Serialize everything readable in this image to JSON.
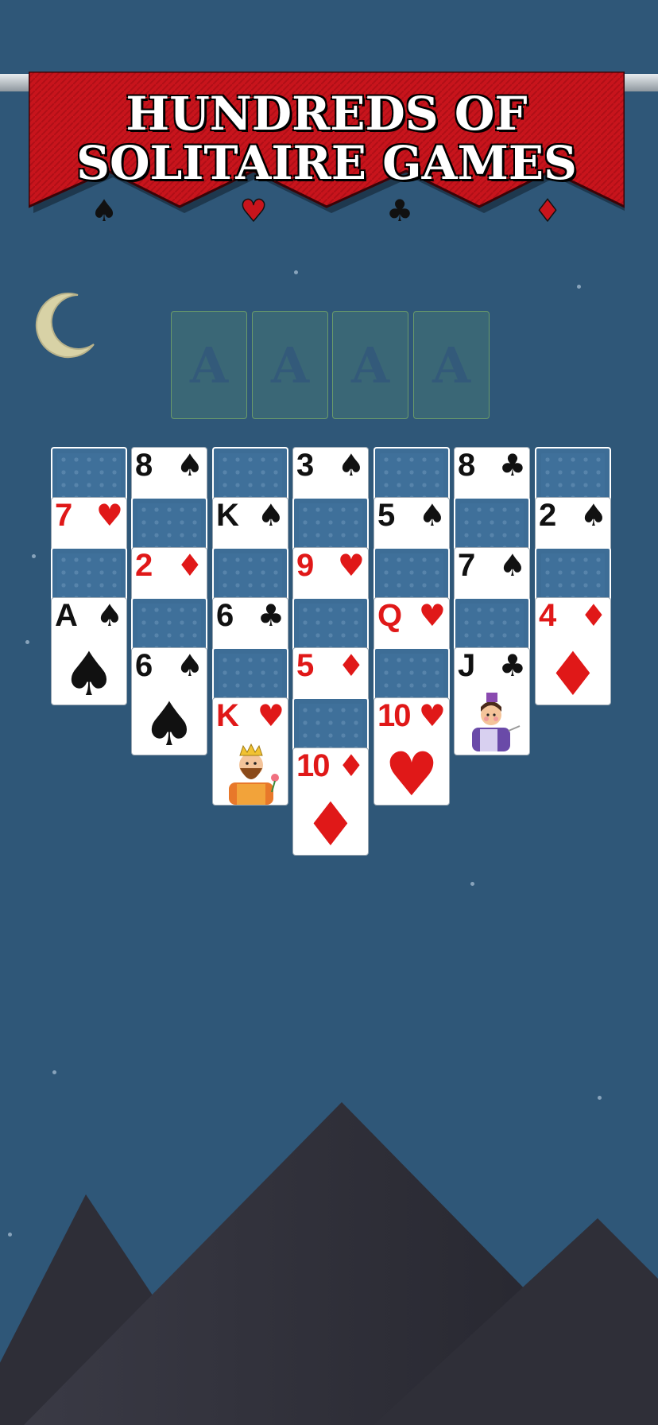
{
  "banner": {
    "line1": "HUNDREDS OF",
    "line2": "SOLITAIRE GAMES",
    "suits": [
      "spade-icon",
      "heart-icon",
      "club-icon",
      "diamond-icon"
    ],
    "color": "#c8141c"
  },
  "foundations": [
    {
      "label": "A"
    },
    {
      "label": "A"
    },
    {
      "label": "A"
    },
    {
      "label": "A"
    }
  ],
  "tableau": {
    "columns": [
      [
        {
          "face": "down"
        },
        {
          "face": "up",
          "rank": "7",
          "suit": "♥",
          "color": "red"
        },
        {
          "face": "down"
        },
        {
          "face": "up",
          "rank": "A",
          "suit": "♠",
          "color": "black"
        }
      ],
      [
        {
          "face": "up",
          "rank": "8",
          "suit": "♠",
          "color": "black"
        },
        {
          "face": "down"
        },
        {
          "face": "up",
          "rank": "2",
          "suit": "♦",
          "color": "red"
        },
        {
          "face": "down"
        },
        {
          "face": "up",
          "rank": "6",
          "suit": "♠",
          "color": "black"
        }
      ],
      [
        {
          "face": "down"
        },
        {
          "face": "up",
          "rank": "K",
          "suit": "♠",
          "color": "black"
        },
        {
          "face": "down"
        },
        {
          "face": "up",
          "rank": "6",
          "suit": "♣",
          "color": "black"
        },
        {
          "face": "down"
        },
        {
          "face": "up",
          "rank": "K",
          "suit": "♥",
          "color": "red",
          "figure": "king"
        }
      ],
      [
        {
          "face": "up",
          "rank": "3",
          "suit": "♠",
          "color": "black"
        },
        {
          "face": "down"
        },
        {
          "face": "up",
          "rank": "9",
          "suit": "♥",
          "color": "red"
        },
        {
          "face": "down"
        },
        {
          "face": "up",
          "rank": "5",
          "suit": "♦",
          "color": "red"
        },
        {
          "face": "down"
        },
        {
          "face": "up",
          "rank": "10",
          "suit": "♦",
          "color": "red"
        }
      ],
      [
        {
          "face": "down"
        },
        {
          "face": "up",
          "rank": "5",
          "suit": "♠",
          "color": "black"
        },
        {
          "face": "down"
        },
        {
          "face": "up",
          "rank": "Q",
          "suit": "♥",
          "color": "red"
        },
        {
          "face": "down"
        },
        {
          "face": "up",
          "rank": "10",
          "suit": "♥",
          "color": "red"
        }
      ],
      [
        {
          "face": "up",
          "rank": "8",
          "suit": "♣",
          "color": "black"
        },
        {
          "face": "down"
        },
        {
          "face": "up",
          "rank": "7",
          "suit": "♠",
          "color": "black"
        },
        {
          "face": "down"
        },
        {
          "face": "up",
          "rank": "J",
          "suit": "♣",
          "color": "black",
          "figure": "jack"
        }
      ],
      [
        {
          "face": "down"
        },
        {
          "face": "up",
          "rank": "2",
          "suit": "♠",
          "color": "black"
        },
        {
          "face": "down"
        },
        {
          "face": "up",
          "rank": "4",
          "suit": "♦",
          "color": "red"
        }
      ]
    ]
  },
  "colors": {
    "background": "#2f5778",
    "card_back": "#3d6d96",
    "red_suit": "#e01818",
    "black_suit": "#111111",
    "mountain": "#33333d"
  }
}
